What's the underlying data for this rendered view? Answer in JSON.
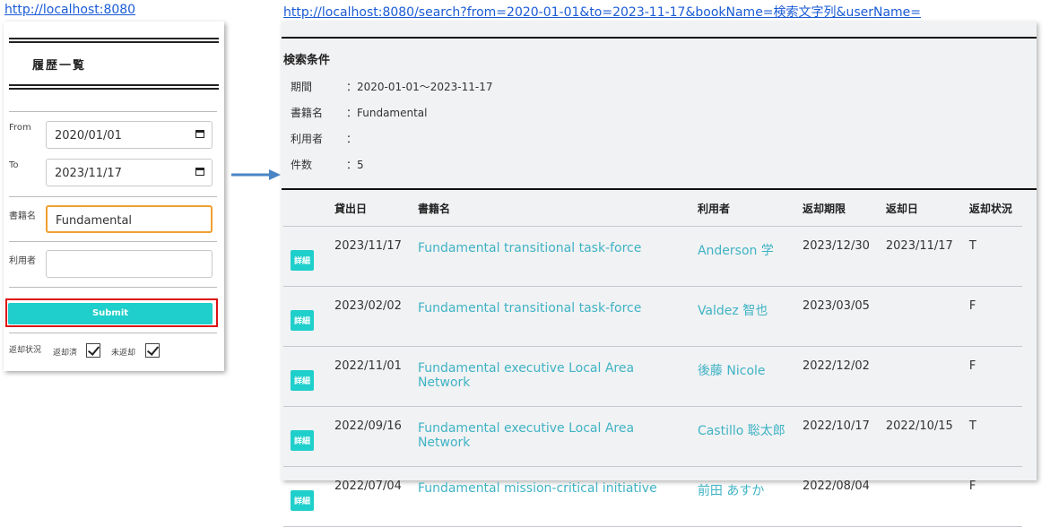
{
  "left_url": "http://localhost:8080",
  "right_url": "http://localhost:8080/search?from=2020-01-01&to=2023-11-17&bookName=検索文字列&userName=",
  "form": {
    "title": "履歴一覧",
    "from_label": "From",
    "from_value": "2020/01/01",
    "to_label": "To",
    "to_value": "2023/11/17",
    "book_label": "書籍名",
    "book_value": "Fundamental",
    "user_label": "利用者",
    "user_value": "",
    "submit_label": "Submit",
    "status_label": "返却状況",
    "returned_label": "返却済",
    "unreturned_label": "未返却"
  },
  "conditions": {
    "title": "検索条件",
    "items": [
      {
        "label": "期間",
        "value": "：2020-01-01～2023-11-17"
      },
      {
        "label": "書籍名",
        "value": "：Fundamental"
      },
      {
        "label": "利用者",
        "value": "："
      },
      {
        "label": "件数",
        "value": "：5"
      }
    ]
  },
  "table": {
    "headers": [
      "",
      "貸出日",
      "書籍名",
      "利用者",
      "返却期限",
      "返却日",
      "返却状況"
    ],
    "detail_label": "詳細",
    "rows": [
      {
        "lend": "2023/11/17",
        "book": "Fundamental transitional task-force",
        "user": "Anderson 学",
        "due": "2023/12/30",
        "returned": "2023/11/17",
        "status": "T"
      },
      {
        "lend": "2023/02/02",
        "book": "Fundamental transitional task-force",
        "user": "Valdez 智也",
        "due": "2023/03/05",
        "returned": "",
        "status": "F"
      },
      {
        "lend": "2022/11/01",
        "book": "Fundamental executive Local Area Network",
        "user": "後藤 Nicole",
        "due": "2022/12/02",
        "returned": "",
        "status": "F"
      },
      {
        "lend": "2022/09/16",
        "book": "Fundamental executive Local Area Network",
        "user": "Castillo 聡太郎",
        "due": "2022/10/17",
        "returned": "2022/10/15",
        "status": "T"
      },
      {
        "lend": "2022/07/04",
        "book": "Fundamental mission-critical initiative",
        "user": "前田 あすか",
        "due": "2022/08/04",
        "returned": "",
        "status": "F"
      }
    ]
  },
  "colors": {
    "accent": "#1fcfcb",
    "link": "#3fb3c4",
    "highlight": "#d11111",
    "focus": "#f0a030"
  }
}
